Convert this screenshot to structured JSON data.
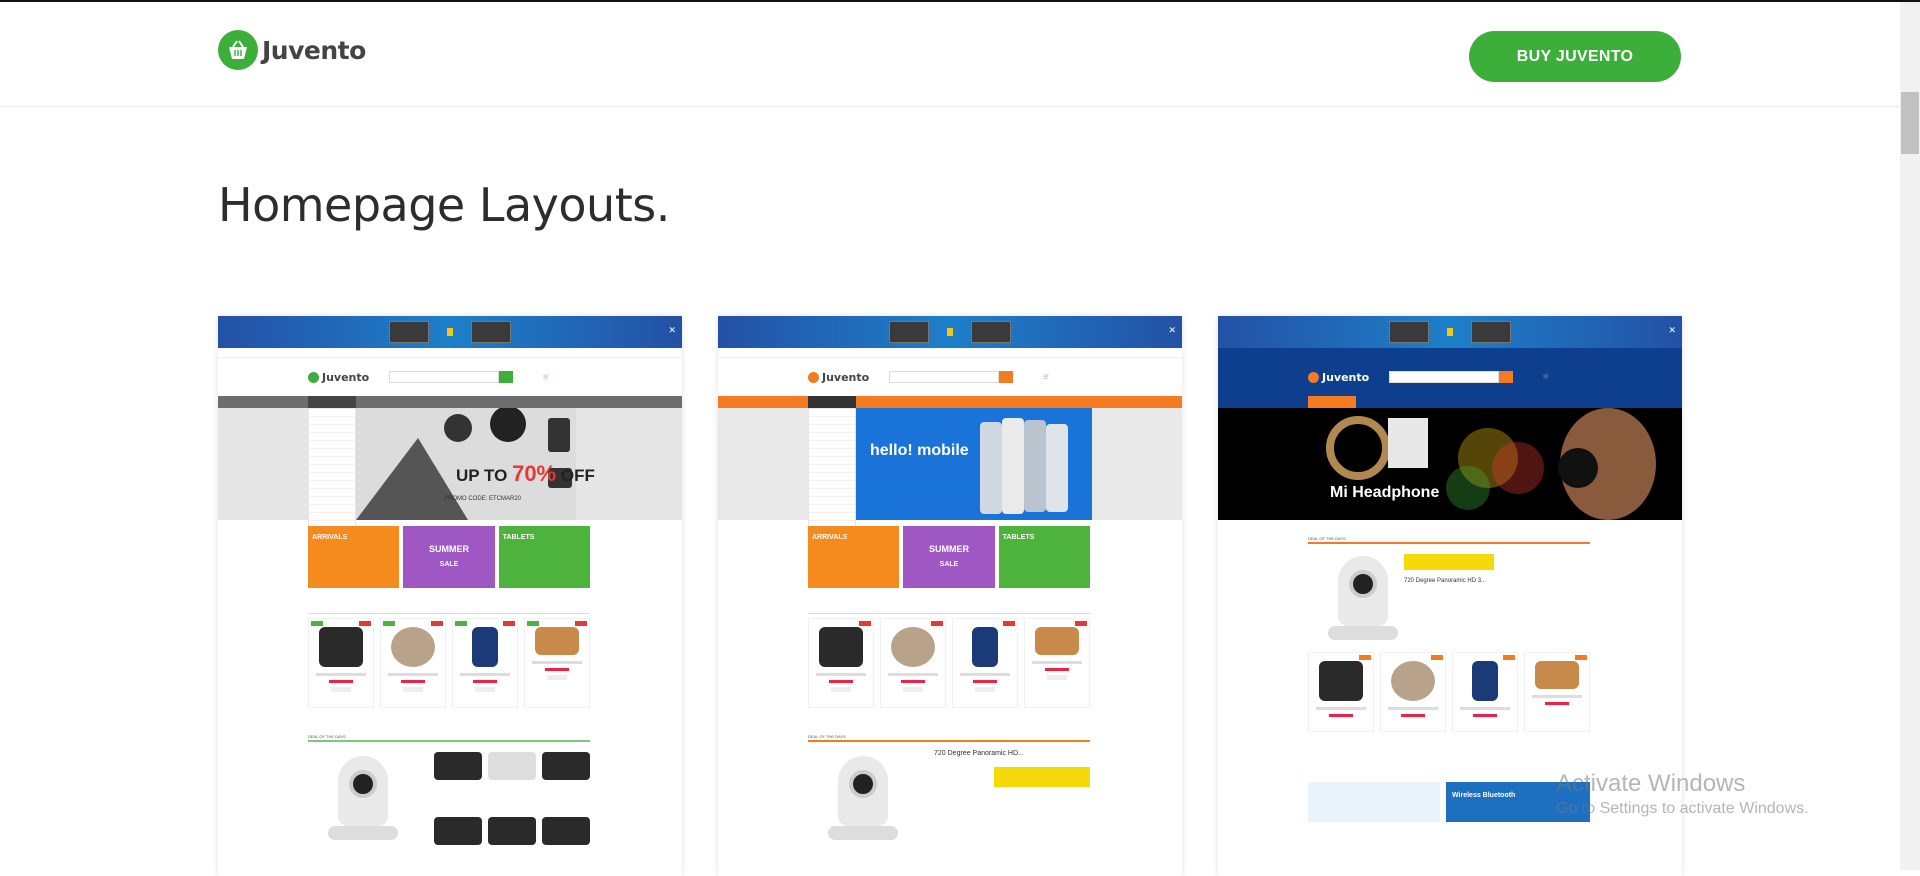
{
  "header": {
    "brand_name": "Juvento",
    "buy_button_label": "BUY JUVENTO"
  },
  "main": {
    "section_title": "Homepage Layouts."
  },
  "layouts": [
    {
      "theme_color": "#6d6d6d",
      "hero_text_1": "UP TO",
      "hero_text_2": "70%",
      "hero_text_3": "OFF",
      "promo_code": "PROMO CODE: ETCMAR20",
      "deal_title": "DEAL OF THE DAYS"
    },
    {
      "theme_color": "#f47c20",
      "hero_text_1": "hello! mobile",
      "deal_title": "DEAL OF THE DAYS",
      "deal_product": "720 Degree Panoramic HD..."
    },
    {
      "theme_color": "#0e3f8f",
      "hero_text_1": "Mi Headphone",
      "deal_title": "DEAL OF THE DAYS",
      "deal_product": "720 Degree Panoramic HD 3...",
      "banner_text": "Wireless Bluetooth"
    }
  ],
  "banners": {
    "new_arrivals": "ARRIVALS",
    "summer": "SUMMER",
    "sale": "SALE",
    "tablets": "TABLETS"
  },
  "watermark": {
    "line1": "Activate Windows",
    "line2": "Go to Settings to activate Windows."
  },
  "colors": {
    "brand_green": "#3cae3a"
  }
}
